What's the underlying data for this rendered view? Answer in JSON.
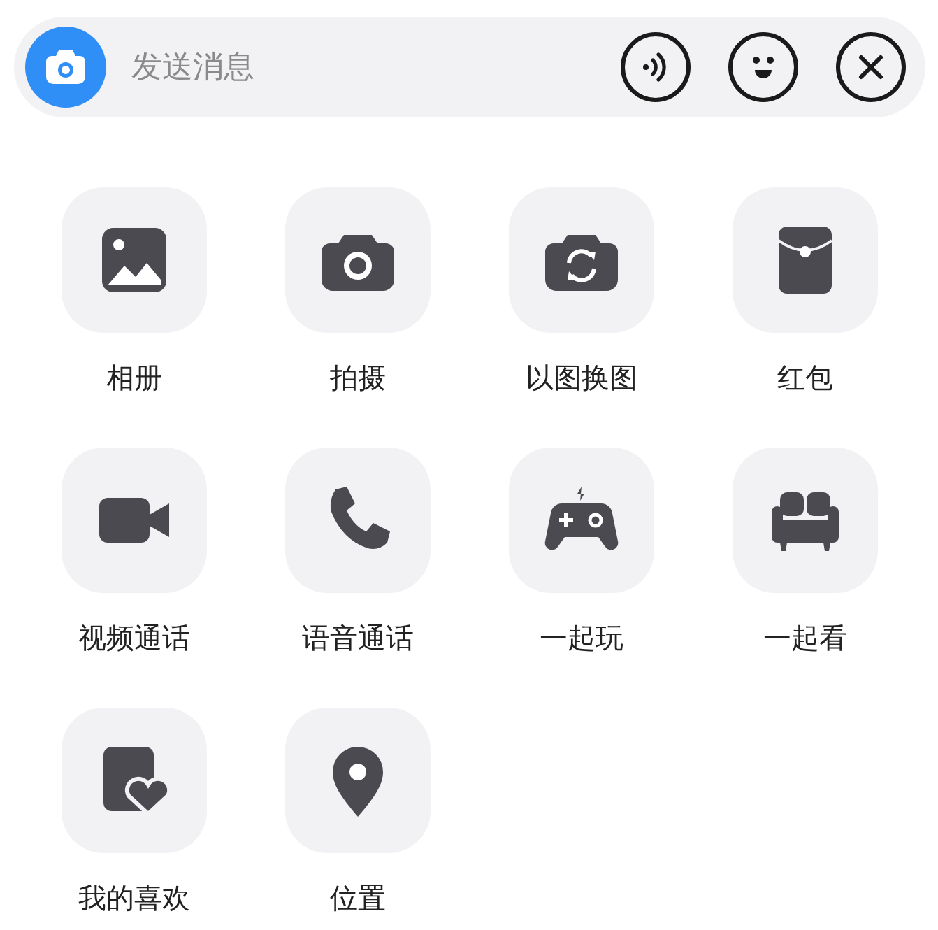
{
  "input_bar": {
    "placeholder": "发送消息"
  },
  "actions": [
    {
      "kind": "album",
      "label": "相册"
    },
    {
      "kind": "camera",
      "label": "拍摄"
    },
    {
      "kind": "swap",
      "label": "以图换图"
    },
    {
      "kind": "packet",
      "label": "红包"
    },
    {
      "kind": "video",
      "label": "视频通话"
    },
    {
      "kind": "phone",
      "label": "语音通话"
    },
    {
      "kind": "game",
      "label": "一起玩"
    },
    {
      "kind": "sofa",
      "label": "一起看"
    },
    {
      "kind": "favorite",
      "label": "我的喜欢"
    },
    {
      "kind": "location",
      "label": "位置"
    }
  ]
}
